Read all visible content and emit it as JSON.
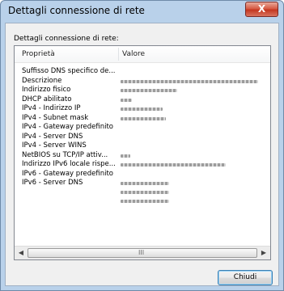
{
  "window": {
    "title": "Dettagli connessione di rete",
    "close_glyph": "X"
  },
  "group_label": "Dettagli connessione di rete:",
  "columns": {
    "property": "Proprietà",
    "value": "Valore"
  },
  "rows": [
    {
      "property": "Suffisso DNS specifico de...",
      "value_lines": 0
    },
    {
      "property": "Descrizione",
      "value_lines": 1
    },
    {
      "property": "Indirizzo fisico",
      "value_lines": 1
    },
    {
      "property": "DHCP abilitato",
      "value_lines": 1
    },
    {
      "property": "IPv4 - Indirizzo IP",
      "value_lines": 1
    },
    {
      "property": "IPv4 - Subnet mask",
      "value_lines": 1
    },
    {
      "property": "IPv4 - Gateway predefinito",
      "value_lines": 0
    },
    {
      "property": "IPv4 - Server DNS",
      "value_lines": 0
    },
    {
      "property": "IPv4 - Server WINS",
      "value_lines": 0
    },
    {
      "property": "NetBIOS su TCP/IP attiv...",
      "value_lines": 1
    },
    {
      "property": "Indirizzo IPv6 locale rispe...",
      "value_lines": 1
    },
    {
      "property": "IPv6 - Gateway predefinito",
      "value_lines": 0
    },
    {
      "property": "IPv6 - Server DNS",
      "value_lines": 3
    }
  ],
  "scrollbar": {
    "left_arrow": "◀",
    "right_arrow": "▶",
    "grip": "III"
  },
  "close_button_label": "Chiudi"
}
